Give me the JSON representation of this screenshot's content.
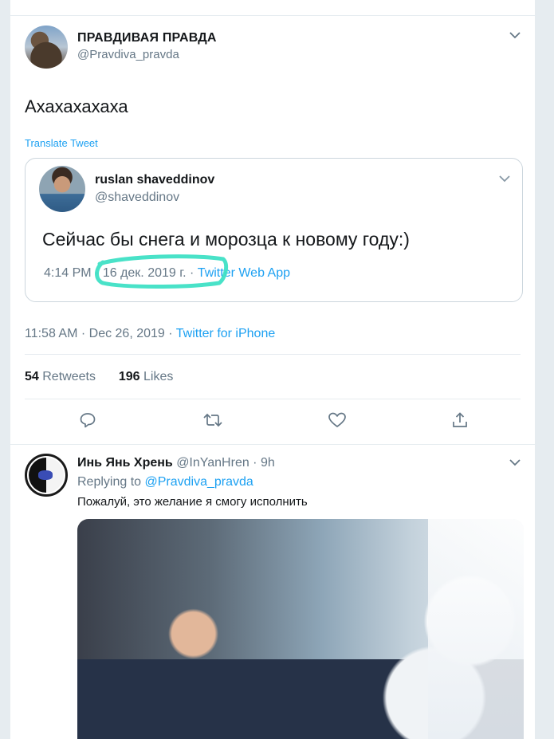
{
  "main_tweet": {
    "display_name": "ПРАВДИВАЯ ПРАВДА",
    "handle": "@Pravdiva_pravda",
    "text": "Ахахахахаха",
    "translate_label": "Translate Tweet",
    "quoted": {
      "display_name": "ruslan shaveddinov",
      "handle": "@shaveddinov",
      "text": "Сейчас бы снега и морозца к новому году:)",
      "time": "4:14 PM",
      "date": "16 дек. 2019 г.",
      "app": "Twitter Web App",
      "highlight_color": "#3fe0c5"
    },
    "timestamp": "11:58 AM · Dec 26, 2019",
    "via": "Twitter for iPhone",
    "retweets_count": "54",
    "retweets_label": "Retweets",
    "likes_count": "196",
    "likes_label": "Likes"
  },
  "reply": {
    "display_name": "Инь Янь Хрень",
    "handle": "@InYanHren",
    "age": "9h",
    "replying_to_label": "Replying to",
    "replying_to_handle": "@Pravdiva_pravda",
    "text": "Пожалуй, это желание я смогу исполнить"
  },
  "colors": {
    "accent": "#1da1f2",
    "muted": "#657786",
    "border": "#e6ecf0"
  }
}
